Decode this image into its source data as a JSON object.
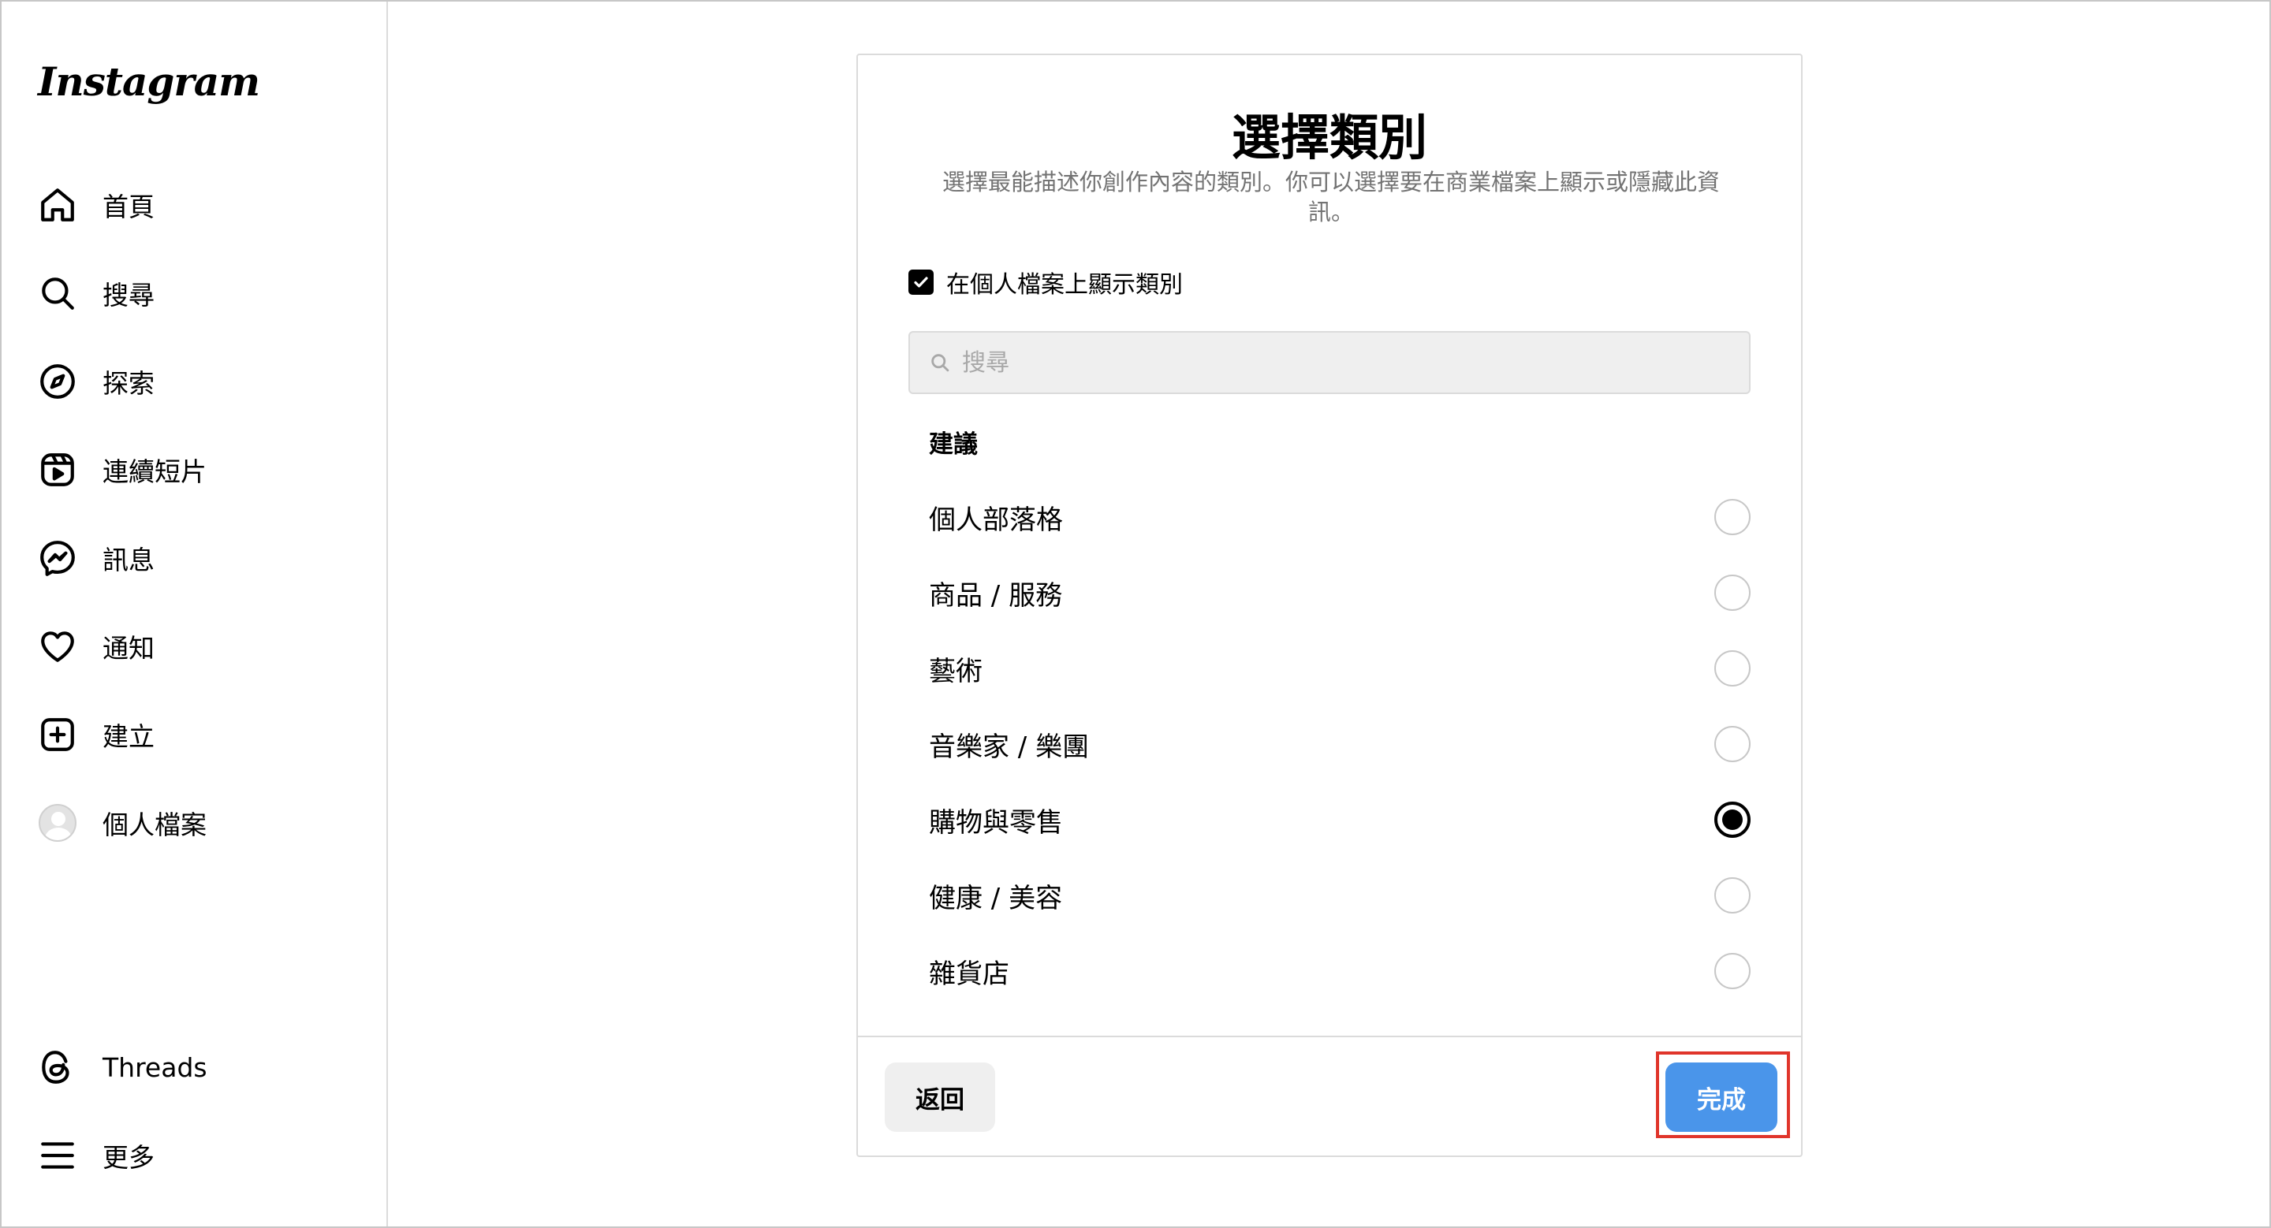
{
  "app": {
    "logo": "Instagram"
  },
  "sidebar": {
    "items": [
      {
        "label": "首頁",
        "icon": "home-icon"
      },
      {
        "label": "搜尋",
        "icon": "search-icon"
      },
      {
        "label": "探索",
        "icon": "compass-icon"
      },
      {
        "label": "連續短片",
        "icon": "reels-icon"
      },
      {
        "label": "訊息",
        "icon": "messenger-icon"
      },
      {
        "label": "通知",
        "icon": "heart-icon"
      },
      {
        "label": "建立",
        "icon": "plus-square-icon"
      },
      {
        "label": "個人檔案",
        "icon": "avatar"
      }
    ],
    "bottom": [
      {
        "label": "Threads",
        "icon": "threads-icon"
      },
      {
        "label": "更多",
        "icon": "menu-icon"
      }
    ]
  },
  "dialog": {
    "title": "選擇類別",
    "subtitle": "選擇最能描述你創作內容的類別。你可以選擇要在商業檔案上顯示或隱藏此資訊。",
    "show_on_profile": {
      "label": "在個人檔案上顯示類別",
      "checked": true
    },
    "search": {
      "placeholder": "搜尋",
      "value": ""
    },
    "section_title": "建議",
    "options": [
      {
        "label": "個人部落格",
        "selected": false
      },
      {
        "label": "商品 / 服務",
        "selected": false
      },
      {
        "label": "藝術",
        "selected": false
      },
      {
        "label": "音樂家 / 樂團",
        "selected": false
      },
      {
        "label": "購物與零售",
        "selected": true
      },
      {
        "label": "健康 / 美容",
        "selected": false
      },
      {
        "label": "雜貨店",
        "selected": false
      }
    ],
    "back_label": "返回",
    "done_label": "完成"
  },
  "colors": {
    "accent": "#4a95ea",
    "highlight": "#e0352b",
    "muted_text": "#737373",
    "border": "#dbdbdb"
  }
}
